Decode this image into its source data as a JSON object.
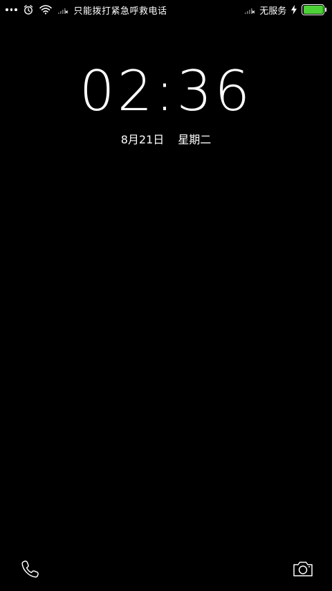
{
  "status_bar": {
    "emergency_text": "只能拨打紧急呼救电话",
    "no_service_text": "无服务",
    "battery_level": 1.0,
    "icons": [
      "more-dots-icon",
      "alarm-icon",
      "wifi-icon",
      "signal-x-icon",
      "signal-x-icon",
      "charging-icon",
      "battery-icon"
    ]
  },
  "lockscreen": {
    "time": "02:36",
    "date": "8月21日",
    "weekday": "星期二"
  },
  "shortcuts": {
    "left": "phone-icon",
    "right": "camera-icon"
  },
  "colors": {
    "background": "#000000",
    "battery": "#4cd137"
  }
}
